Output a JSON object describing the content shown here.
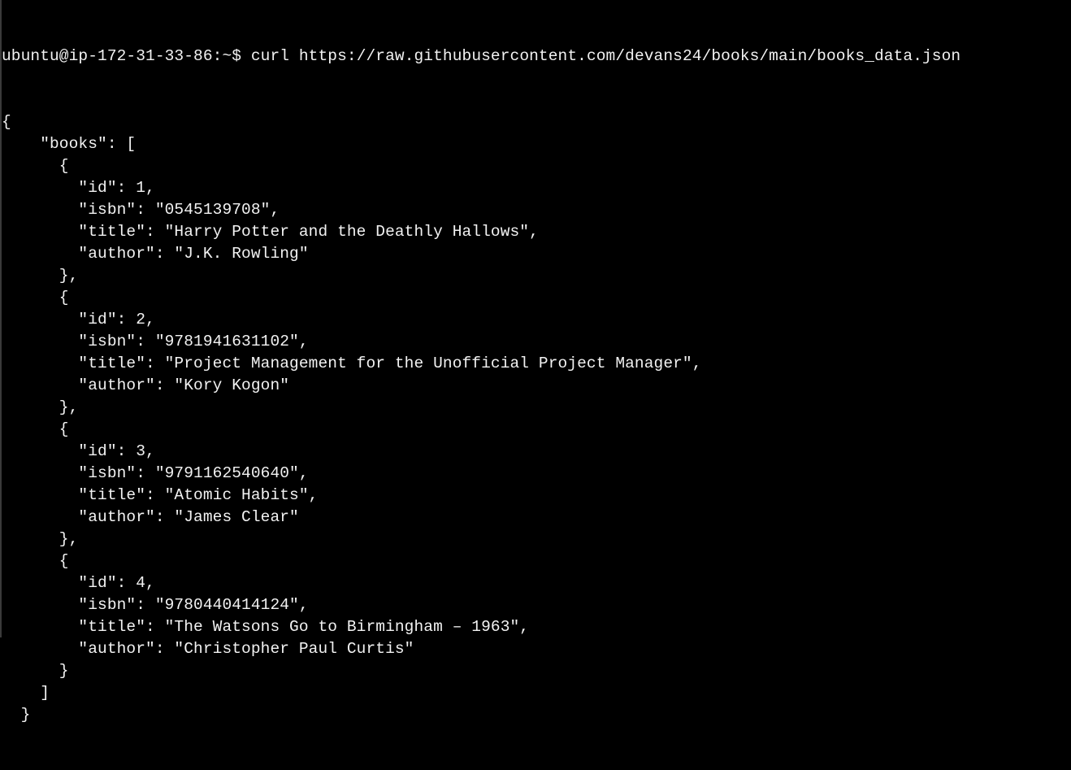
{
  "terminal": {
    "prompt": "ubuntu@ip-172-31-33-86:~$",
    "command": "curl https://raw.githubusercontent.com/devans24/books/main/books_data.json",
    "output_lines": [
      "{",
      "    \"books\": [",
      "      {",
      "        \"id\": 1,",
      "        \"isbn\": \"0545139708\",",
      "        \"title\": \"Harry Potter and the Deathly Hallows\",",
      "        \"author\": \"J.K. Rowling\"",
      "      },",
      "      {",
      "        \"id\": 2,",
      "        \"isbn\": \"9781941631102\",",
      "        \"title\": \"Project Management for the Unofficial Project Manager\",",
      "        \"author\": \"Kory Kogon\"",
      "      },",
      "      {",
      "        \"id\": 3,",
      "        \"isbn\": \"9791162540640\",",
      "        \"title\": \"Atomic Habits\",",
      "        \"author\": \"James Clear\"",
      "      },",
      "      {",
      "        \"id\": 4,",
      "        \"isbn\": \"9780440414124\",",
      "        \"title\": \"The Watsons Go to Birmingham – 1963\",",
      "        \"author\": \"Christopher Paul Curtis\"",
      "      }",
      "    ]",
      "  }"
    ]
  },
  "books_data": {
    "books": [
      {
        "id": 1,
        "isbn": "0545139708",
        "title": "Harry Potter and the Deathly Hallows",
        "author": "J.K. Rowling"
      },
      {
        "id": 2,
        "isbn": "9781941631102",
        "title": "Project Management for the Unofficial Project Manager",
        "author": "Kory Kogon"
      },
      {
        "id": 3,
        "isbn": "9791162540640",
        "title": "Atomic Habits",
        "author": "James Clear"
      },
      {
        "id": 4,
        "isbn": "9780440414124",
        "title": "The Watsons Go to Birmingham – 1963",
        "author": "Christopher Paul Curtis"
      }
    ]
  }
}
